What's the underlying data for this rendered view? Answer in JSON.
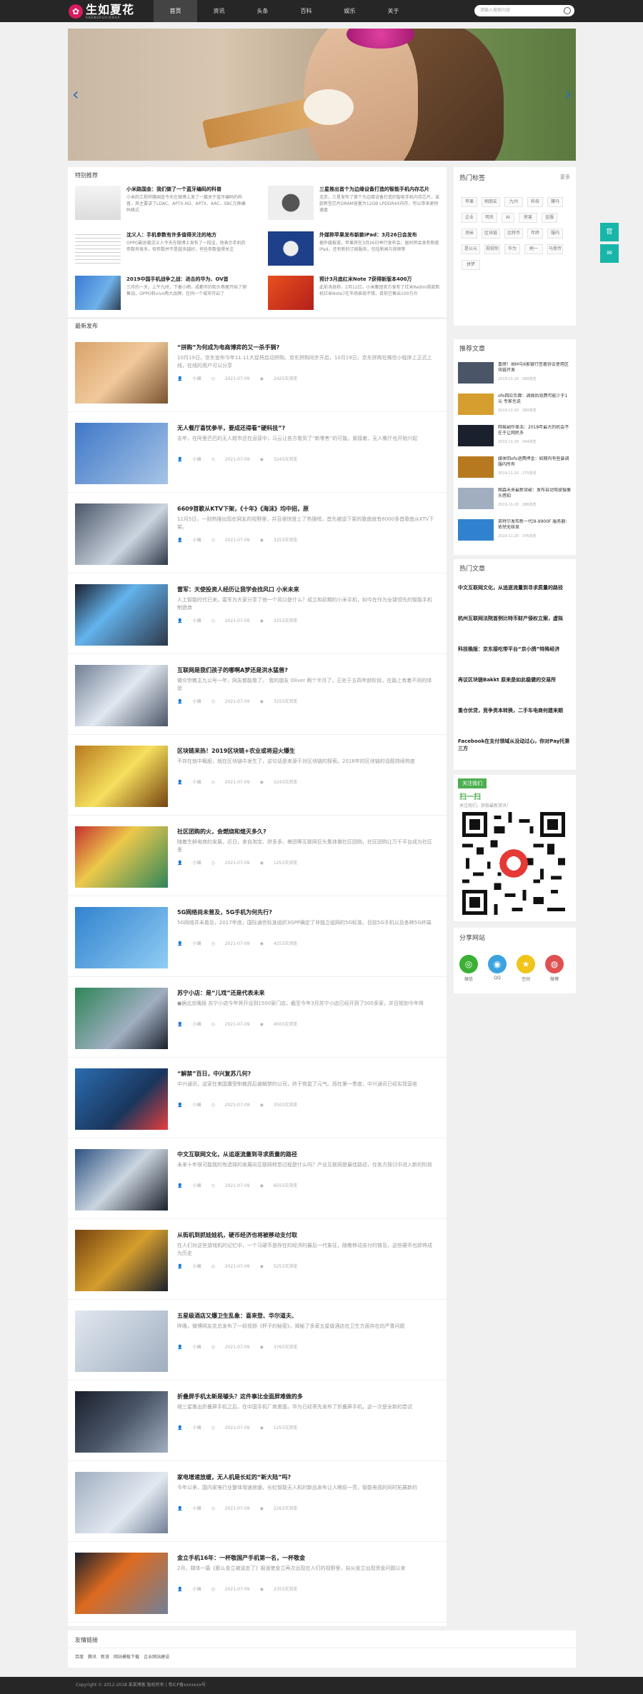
{
  "header": {
    "logo_text": "生如夏花",
    "logo_sub": "SHENGRUXIAHUA",
    "search_placeholder": "请输入搜索内容",
    "nav": [
      "首页",
      "资讯",
      "头条",
      "百科",
      "娱乐",
      "关于"
    ]
  },
  "featured": {
    "title": "特别推荐",
    "items": [
      {
        "title": "小米路国金：我们做了一个蓝牙编码的科普",
        "desc": "小米的工程师路国金今天在微博上发了一篇关于蓝牙编码的科普，其主要讲了LDAC、APTX-HD、APTX、AAC、SBC几种编码格式"
      },
      {
        "title": "三星推出首个为边缘设备打造的智能手机内存芯片",
        "desc": "北京，三星发布了首个为边缘设备打造的智能手机内存芯片，该款新型芯片DRAM容量为12GB LPDDR4X内存，可以带来更快速度"
      },
      {
        "title": "沈义人：手机参数有许多值得关注的地方",
        "desc": "OPPO副总裁沈义人今天在微博上发布了一段话，他表示手机的参数有很多，但参数并不是越多越好，有些参数值得关注"
      },
      {
        "title": "外媒称苹果发布新款iPad：3月26日会发布",
        "desc": "据外媒报道，苹果将在3月26日举行发布会。届时将会发布新款iPad，还有新的订阅服务，包括新闻与视频等"
      },
      {
        "title": "2019中国手机战争之战：进击的华为、OV首",
        "desc": "三月的一天，上午九时，下着小雨，成都市的街头巷尾开始了销售战，OPPO和vivo两大品牌，在同一个城市开启了"
      },
      {
        "title": "预计3月底红米Note 7获得新版本400万",
        "desc": "此前消息称，2月12日，小米集团官方发布了红米Redmi首款新机红米Note7在市场表现不错，目前已售出100万台"
      }
    ]
  },
  "latest": {
    "title": "最新发布",
    "items": [
      {
        "title": "“拼购”为何成为电商博弈的又一杀手锏?",
        "desc": "10月19日，京东宣布今年11.11大促将启动拼购。京东拼购同步开启，10月19日，京东拼购在微信小程序上正式上线，在线的用户可以分享",
        "author": "小编",
        "date": "2021-07-09",
        "views": "2425次浏览"
      },
      {
        "title": "无人餐厅喜忧参半，要成还得看“硬科技”?",
        "desc": "去年，在阿里巴巴的无人超市还在运营中，马云让各方看到了“新零售”的可能。紧接着，无人餐厅也开始兴起",
        "author": "小编",
        "date": "2021-07-09",
        "views": "3243次浏览"
      },
      {
        "title": "6609首歌从KTV下架，《十年》《海沫》均中招，原",
        "desc": "11月5日，一则热搜出现在网友的视野里，并且很快登上了热搜榜。首先被迫下架的歌曲就有6000多首歌曲从KTV下架。",
        "author": "小编",
        "date": "2021-07-09",
        "views": "3253次浏览"
      },
      {
        "title": "雷军：天使投资人经历让我学会找风口 小米未来",
        "desc": "人工智能时代已来。雷军为大家分享了他一个风口是什么？成立和初期的小米手机，如今在作为全球领先的智能手机制造商",
        "author": "小编",
        "date": "2021-07-09",
        "views": "3253次浏览"
      },
      {
        "title": "互联网是我们孩子的哪啊A梦还是洪水猛兽?",
        "desc": "微众宗教主九公号一年，网友都能看了。 我的朋友 Oliver 两个半月了，正处于五四年龄阶段，在路上有着不同的体验",
        "author": "小编",
        "date": "2021-07-09",
        "views": "3253次浏览"
      },
      {
        "title": "区块链来热！2019区块链+农业或将迎火爆生",
        "desc": "不存在就中概股，就在区块链中发生了，这句话是来源于对区块链的探索。2018年的区块链的话题持续热度",
        "author": "小编",
        "date": "2021-07-09",
        "views": "3243次浏览"
      },
      {
        "title": "社区团购的火，会燃烧和熄灭多久?",
        "desc": "随着生鲜电商的发展，近日，来自淘宝、拼多多、美团等互联网巨头集体做社区团购，社区团购让万千平台成为社区里",
        "author": "小编",
        "date": "2021-07-09",
        "views": "1253次浏览"
      },
      {
        "title": "5G网络尚未普及，5G手机为何先行?",
        "desc": "5G网络并未普及，2017年底，国际通信标准组织3GPP确定了非独立组网的5G标准。目前5G手机以及各种5G终端",
        "author": "小编",
        "date": "2021-07-09",
        "views": "4253次浏览"
      },
      {
        "title": "苏宁小店：是“儿戏”还是代表未来",
        "desc": "●据北京晚报 苏宁小店今年将开设到1500家门店，截至今年3月苏宁小店已经开到了500多家，并且规划今年将",
        "author": "小编",
        "date": "2021-07-09",
        "views": "4503次浏览"
      },
      {
        "title": "“解禁”百日，中兴复苏几何?",
        "desc": "中兴通讯，这家在美国遭受制裁而后被解禁的公司，终于恢复了元气。而在第一季度，中兴通讯已经实现营收",
        "author": "小编",
        "date": "2021-07-09",
        "views": "3503次浏览"
      },
      {
        "title": "中文互联网文化，从追逐流量到寻求质量的路径",
        "desc": "未来十年很可能我的有选择的发展向互联网转型过程是什么吗？产业互联网是最佳路径，在各方探讨中进入新的阶段",
        "author": "小编",
        "date": "2021-07-09",
        "views": "6553次浏览"
      },
      {
        "title": "从街机到抓娃娃机，硬币经济也将被移动支付取",
        "desc": "在人们对这些游戏机的记忆中，一个马硬币是存在的经济的最后一代象征，随着移动支付的普及，这些硬币也即将成为历史",
        "author": "小编",
        "date": "2021-07-09",
        "views": "5253次浏览"
      },
      {
        "title": "五星级酒店又爆卫生乱象：喜来登、华尔道夫、",
        "desc": "昨晚，微博网友花总发布了一段视频《杯子的秘密》，揭秘了多家五星级酒店在卫生方面存在的严重问题",
        "author": "小编",
        "date": "2021-07-09",
        "views": "3763次浏览"
      },
      {
        "title": "折叠屏手机太新是噱头？这件事比全面屏难做的多",
        "desc": "继三星推出折叠屏手机之后，在中国手机厂商里面，华为已经率先发布了折叠屏手机，这一次是全新的尝试",
        "author": "小编",
        "date": "2021-07-09",
        "views": "1253次浏览"
      },
      {
        "title": "家电增速放缓，无人机是长虹的“新大陆”吗?",
        "desc": "今年以来，国内家电行业整体增速放缓，长虹智能无人机的新品发布让人眼前一亮，智能电视的同时拓展新的",
        "author": "小编",
        "date": "2021-07-09",
        "views": "2263次浏览"
      },
      {
        "title": "金立手机16年：一杯敬国产手机第一名，一杯敬金",
        "desc": "2月，媒体一篇《那么金立被送走了》报道使金立再次出现在人们的视野里，自从金立出现资金问题以来",
        "author": "小编",
        "date": "2021-07-09",
        "views": "2353次浏览"
      }
    ]
  },
  "sidebar": {
    "tags_title": "热门标签",
    "tags_more": "更多",
    "tags": [
      "苹果",
      "刷朋友",
      "九州",
      "科技",
      "赚马",
      "企业",
      "明天",
      "AI",
      "房害",
      "金服",
      "测米",
      "区块链",
      "比特币",
      "年终",
      "服内",
      "是以元",
      "视视你",
      "华为",
      "刷一",
      "马恩传",
      "拼梦"
    ],
    "rec_title": "推荐文章",
    "rec": [
      {
        "title": "重磅！IBM与6家银行签署协议使用区块链开发",
        "date": "2019-11-20",
        "views": "289浏览"
      },
      {
        "title": "ofo回应负面：调拨后效费可能少于1元 专家也说",
        "date": "2019-11-20",
        "views": "289浏览"
      },
      {
        "title": "网易副作美浩：2018年最大的机会不在于让网民多",
        "date": "2019-11-20",
        "views": "294浏览"
      },
      {
        "title": "媒体回ofo退费押金：如期内有些要调服内所有",
        "date": "2019-11-20",
        "views": "275浏览"
      },
      {
        "title": "图森未来最新突破：发布自动驾驶摄像头感知",
        "date": "2019-11-20",
        "views": "286浏览"
      },
      {
        "title": "英特尔发布新一代i9-9900F 服务器：依然无核显",
        "date": "2019-11-20",
        "views": "376浏览"
      }
    ],
    "hot_title": "热门文章",
    "hot": [
      "中文互联网文化，从追逐流量到寻求质量的路径",
      "杭州互联网法院首例比特币财产侵权立案，虚拟",
      "科技晚报：京东接吃带平台“京小鸽”特殊经济",
      "再议区块链Bakkt 原来是如此稳健的交易所",
      "重仓优贷，竞争资本转换，二手车电商何建来期",
      "Facebook在支付领域从没动过心，你对Pay托第三方"
    ],
    "follow_title": "关注我们",
    "follow_sub": "扫一扫",
    "follow_desc": "关注我们，获取最新资讯！",
    "share_title": "分享网站",
    "share": [
      {
        "label": "微信",
        "color": "#3cb034",
        "icon": "◎"
      },
      {
        "label": "QQ",
        "color": "#3ba3e0",
        "icon": "◉"
      },
      {
        "label": "空间",
        "color": "#f0c419",
        "icon": "★"
      },
      {
        "label": "微博",
        "color": "#e05050",
        "icon": "◍"
      }
    ]
  },
  "links": {
    "title": "友情链接",
    "items": [
      "百度",
      "腾讯",
      "新浪",
      "网站模板下载",
      "企业网站建设"
    ]
  },
  "footer": {
    "text": "Copyright © 2012-2018 某某博客 版权所有 | 粤ICP备xxxxxxx号"
  },
  "side_buttons": [
    "官",
    "✉"
  ]
}
